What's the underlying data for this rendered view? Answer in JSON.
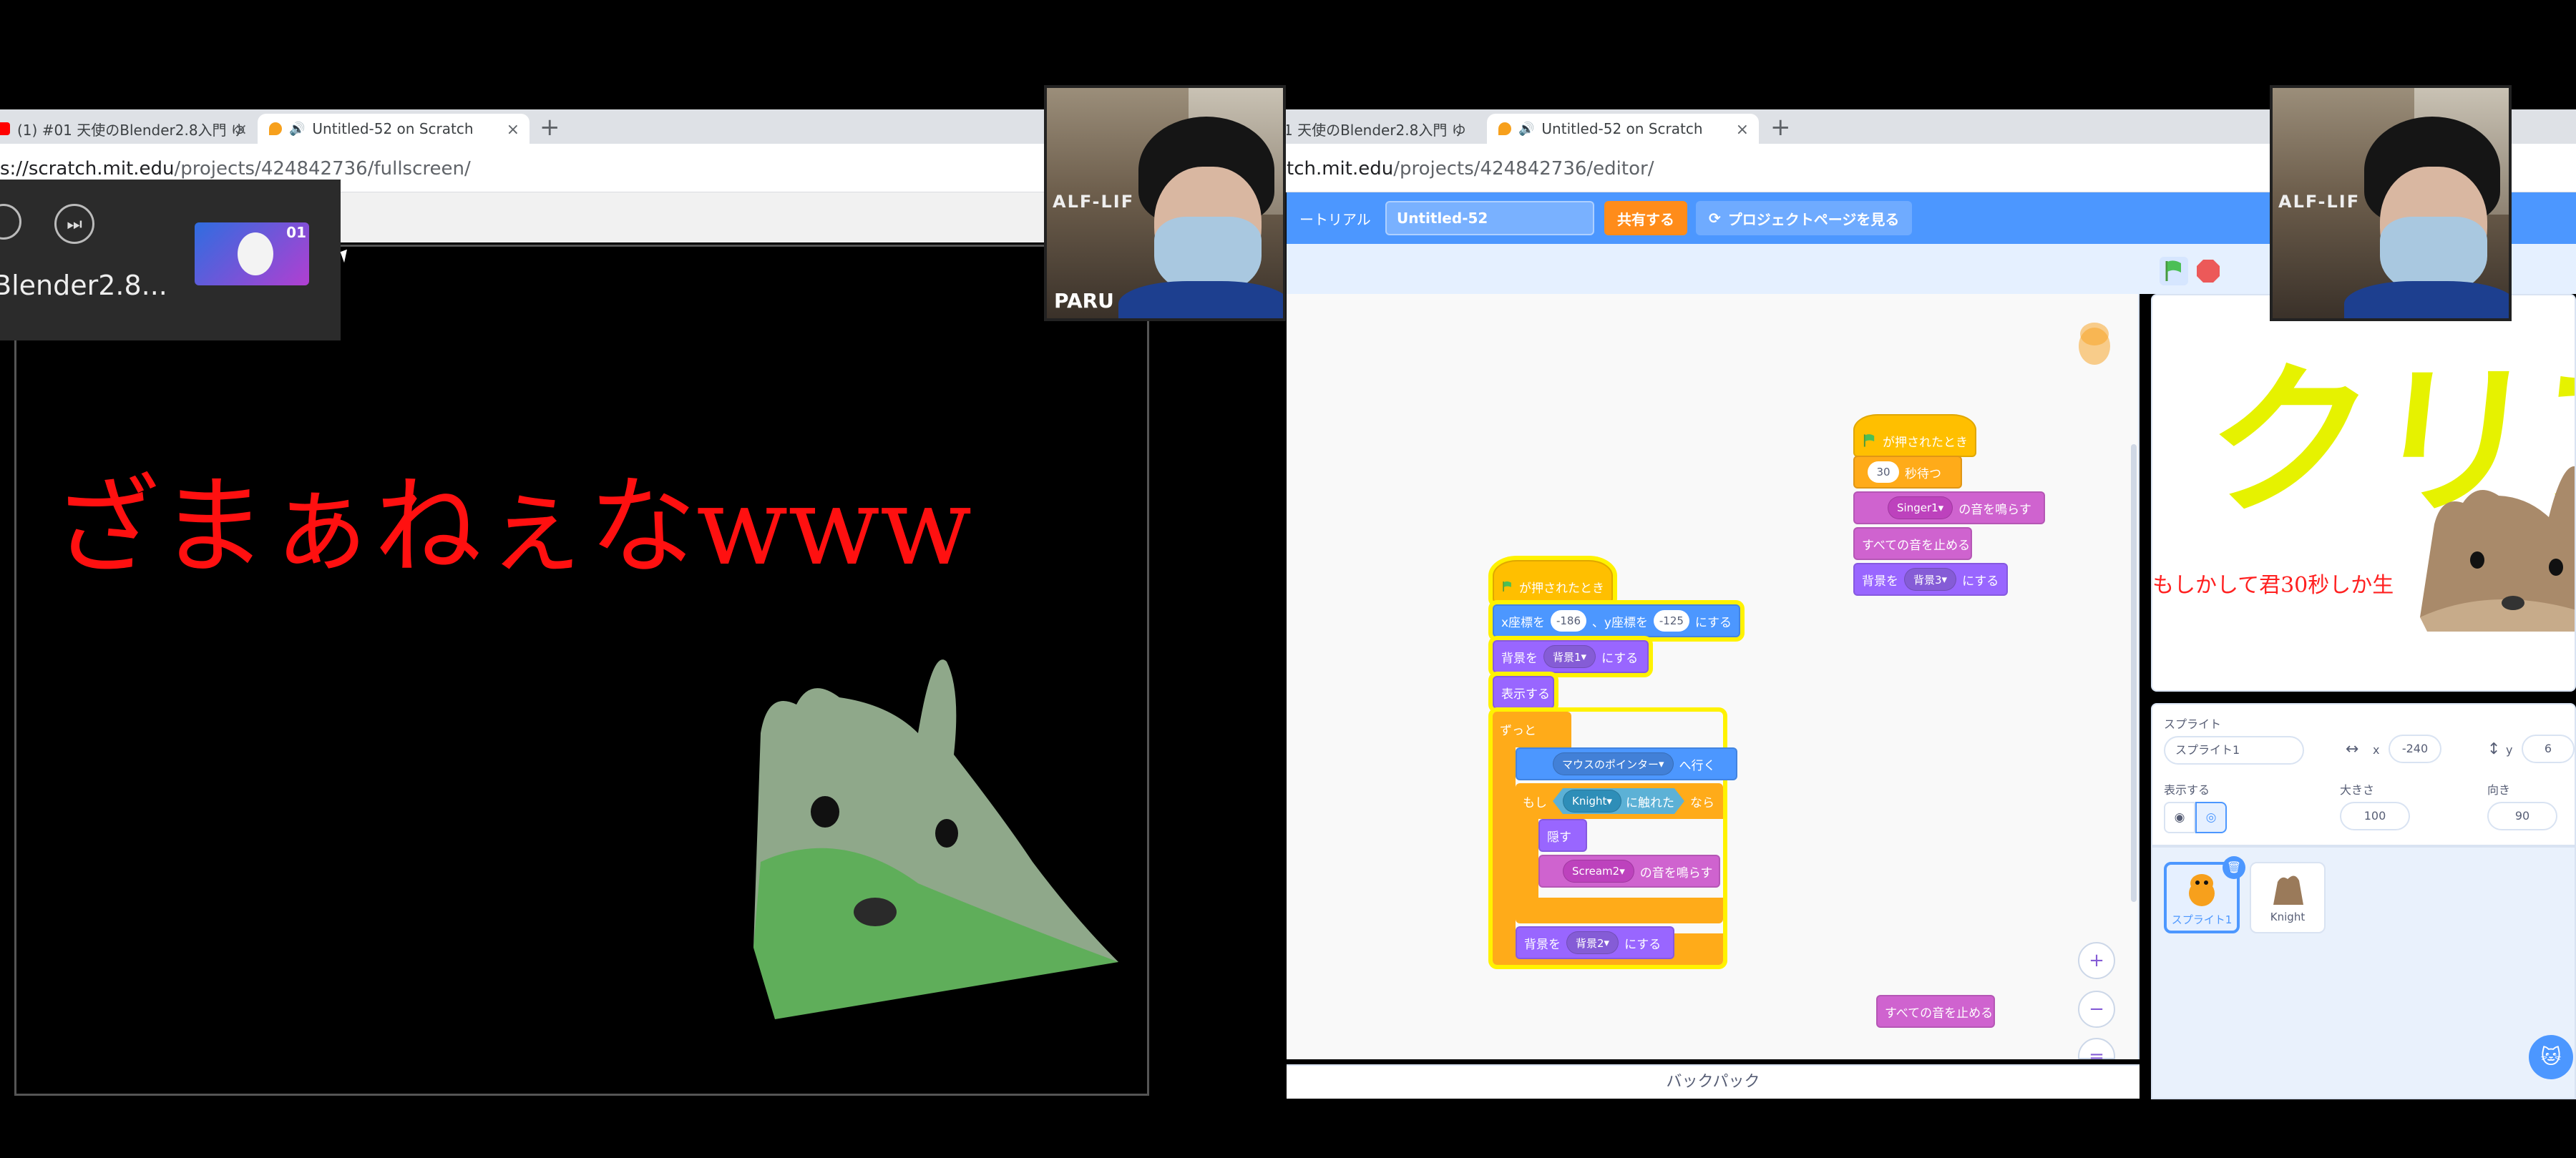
{
  "left": {
    "tabs": [
      {
        "label": "(1) #01 天使のBlender2.8入門 ゆ"
      },
      {
        "label": "Untitled-52 on Scratch"
      }
    ],
    "url_prefix": "s://scratch.mit.edu",
    "url_rest": "/projects/424842736/fullscreen/",
    "media": {
      "title": "Blender2.8...",
      "thumb_label": "01"
    },
    "stage_text": "ざまぁねぇなwww"
  },
  "webcam": {
    "name_tag": "PARU",
    "game_logo": "ALF-LIF"
  },
  "right": {
    "tabs": [
      {
        "label": "1 天使のBlender2.8入門 ゆ"
      },
      {
        "label": "Untitled-52 on Scratch"
      }
    ],
    "url_prefix": "tch.mit.edu",
    "url_rest": "/projects/424842736/editor/",
    "menu": {
      "tutorial": "ートリアル",
      "project_title": "Untitled-52",
      "share": "共有する",
      "see_project_page": "プロジェクトページを見る"
    },
    "scripts": {
      "s1": {
        "hat": "が押されたとき",
        "wait_value": "30",
        "wait_label": "秒待つ",
        "sound1_name": "Singer1",
        "sound1_label": "の音を鳴らす",
        "stop_sounds": "すべての音を止める",
        "costume_prefix": "背景を",
        "costume_value": "背景3",
        "costume_suffix": "にする"
      },
      "s2": {
        "hat": "が押されたとき",
        "x_label": "x座標を",
        "x_value": "-186",
        "y_label": "、y座標を",
        "y_value": "-125",
        "goto_suffix": "にする",
        "costume_prefix": "背景を",
        "costume_value": "背景1",
        "costume_suffix": "にする",
        "show": "表示する",
        "forever": "ずっと",
        "goto_target": "マウスのポインター",
        "goto_label": "へ行く",
        "if_label": "もし",
        "touch_target": "Knight",
        "touch_label": "に触れた",
        "then_label": "なら",
        "hide": "隠す",
        "sound_name": "Scream2",
        "sound_label": "の音を鳴らす",
        "costume2_prefix": "背景を",
        "costume2_value": "背景2",
        "costume2_suffix": "にする"
      },
      "loose_block": "すべての音を止める"
    },
    "backpack": "バックパック",
    "stage": {
      "clear_text": "クリア",
      "sub_text": "もしかして君30秒しか生"
    },
    "sprite_info": {
      "sprite_label": "スプライト",
      "sprite_name": "スプライト1",
      "x_label": "x",
      "x_value": "-240",
      "y_label": "y",
      "y_value": "6",
      "show_label": "表示する",
      "size_label": "大きさ",
      "size_value": "100",
      "direction_label": "向き",
      "direction_value": "90"
    },
    "sprites": [
      {
        "name": "スプライト1"
      },
      {
        "name": "Knight"
      }
    ]
  },
  "colors": {
    "scratch_blue": "#4c97ff",
    "events_yellow": "#ffbf00",
    "control_orange": "#ffab19",
    "looks_purple": "#9966ff",
    "sound_magenta": "#cf63cf",
    "sensing_cyan": "#5cb1d6",
    "red_text": "#ff1010",
    "clear_yellow": "#e6f200"
  }
}
